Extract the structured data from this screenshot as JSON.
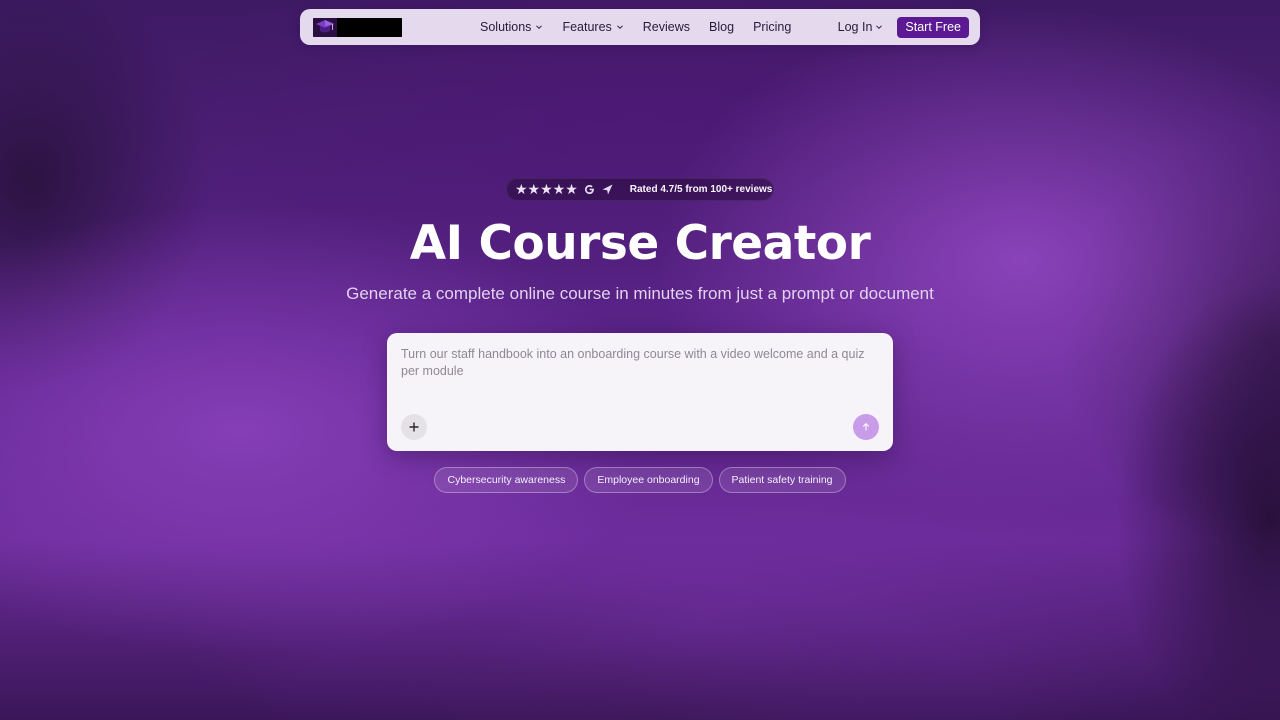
{
  "nav": {
    "links": [
      {
        "label": "Solutions",
        "has_dropdown": true
      },
      {
        "label": "Features",
        "has_dropdown": true
      },
      {
        "label": "Reviews",
        "has_dropdown": false
      },
      {
        "label": "Blog",
        "has_dropdown": false
      },
      {
        "label": "Pricing",
        "has_dropdown": false
      }
    ],
    "login_label": "Log In",
    "cta_label": "Start Free"
  },
  "rating": {
    "stars": "★★★★★",
    "star_count": 5,
    "text": "Rated 4.7/5 from 100+ reviews"
  },
  "hero": {
    "title": "AI Course Creator",
    "subtitle": "Generate a complete online course in minutes from just a prompt or document"
  },
  "prompt": {
    "placeholder": "Turn our staff handbook into an onboarding course with a video welcome and a quiz per module",
    "add_icon": "plus-icon",
    "send_icon": "arrow-up-icon"
  },
  "chips": [
    "Cybersecurity awareness",
    "Employee onboarding",
    "Patient safety training"
  ],
  "colors": {
    "brand": "#5b1a93",
    "send_button": "#c89ce9",
    "background": "#5a2388"
  }
}
